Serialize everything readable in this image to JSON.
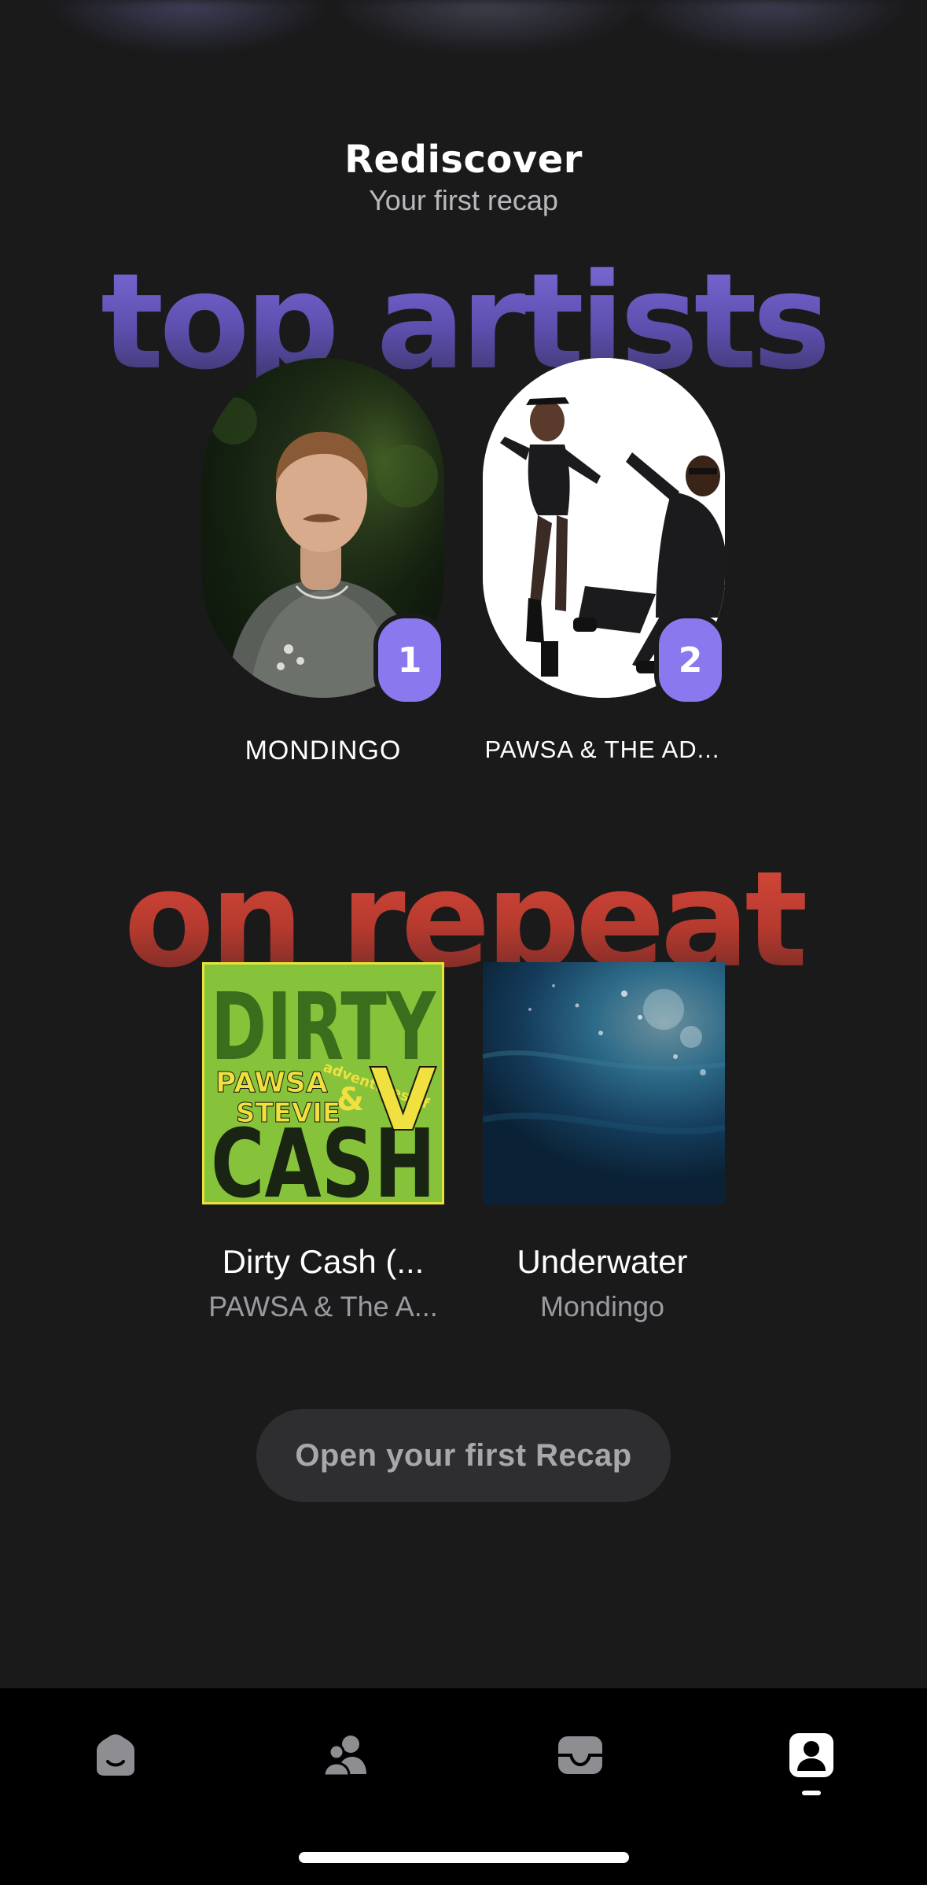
{
  "header": {
    "title": "Rediscover",
    "subtitle": "Your first recap"
  },
  "sections": {
    "top_artists_label": "top artists",
    "on_repeat_label": "on repeat"
  },
  "top_artists": [
    {
      "rank": "1",
      "name": "MONDINGO"
    },
    {
      "rank": "2",
      "name": "PAWSA & THE AD..."
    }
  ],
  "on_repeat": [
    {
      "title": "Dirty Cash (...",
      "artist": "PAWSA & The A...",
      "cover_text": [
        "DIRTY",
        "CASH",
        "PAWSA",
        "STEVIE",
        "adventures of",
        "&",
        "V"
      ]
    },
    {
      "title": "Underwater",
      "artist": "Mondingo"
    }
  ],
  "cta": {
    "label": "Open your first Recap"
  },
  "tabbar": {
    "items": [
      "home-icon",
      "friends-icon",
      "inbox-icon",
      "profile-icon"
    ],
    "active": "profile-icon"
  },
  "colors": {
    "background": "#1a1a1b",
    "accent_purple": "#8a79ee",
    "accent_red": "#c0392b",
    "tabbar": "#000000"
  }
}
